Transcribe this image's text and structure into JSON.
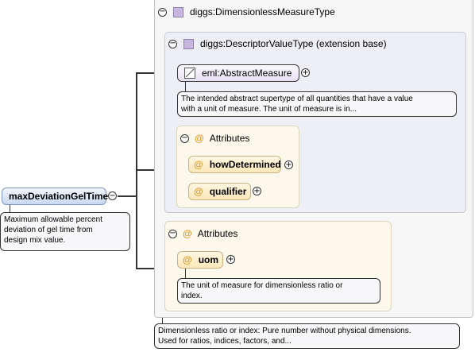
{
  "root": {
    "name": "maxDeviationGelTime",
    "doc": [
      "Maximum allowable percent",
      "deviation of gel time from",
      "design mix value."
    ]
  },
  "type": {
    "title": "diggs:DimensionlessMeasureType",
    "doc": [
      "Dimensionless ratio or index: Pure number without physical dimensions.",
      "Used for ratios, indices, factors, and..."
    ]
  },
  "base": {
    "title": "diggs:DescriptorValueType (extension base)"
  },
  "abstract_measure": {
    "name": "eml:AbstractMeasure",
    "doc": [
      "The intended abstract supertype of all quantities that have a value",
      "with a unit of measure. The unit of measure is in..."
    ]
  },
  "base_attributes": {
    "title": "Attributes",
    "items": [
      "howDetermined",
      "qualifier"
    ]
  },
  "type_attributes": {
    "title": "Attributes",
    "uom": "uom",
    "uom_doc": [
      "The unit of measure for dimensionless ratio or",
      "index."
    ]
  },
  "glyphs": {
    "collapse": "⊖",
    "expand": "⊕",
    "at": "@",
    "minus": "−",
    "plus": "+"
  },
  "colors": {
    "attribute_at": "#d99a2a",
    "type_square": "#c7b7e0",
    "element_blue": "#c9d9f1"
  }
}
